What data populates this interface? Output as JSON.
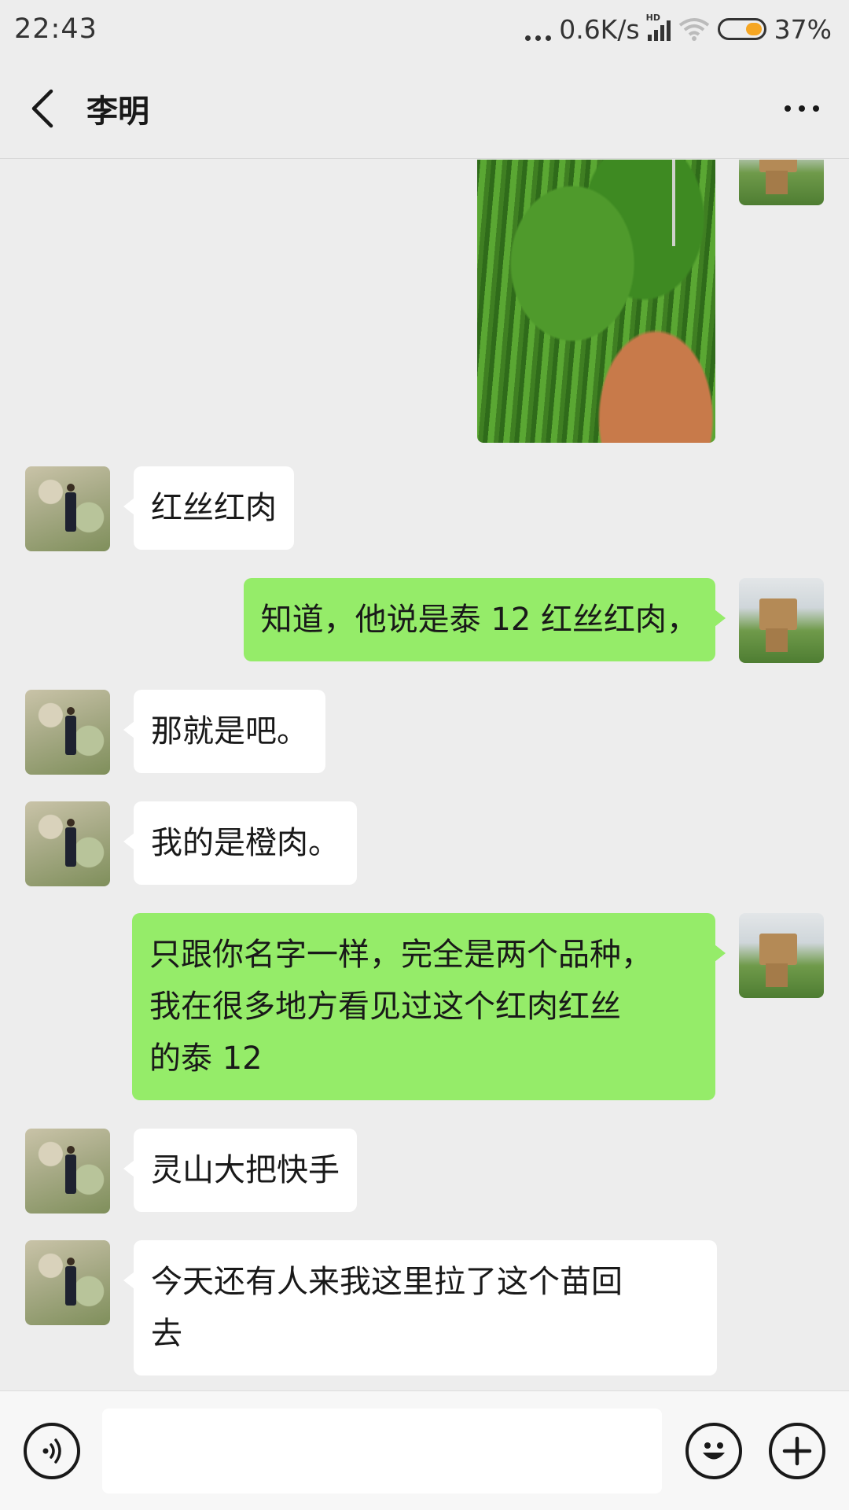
{
  "status_bar": {
    "time": "22:43",
    "network_speed": "0.6K/s",
    "signal_badge": "HD",
    "battery": "37%"
  },
  "nav": {
    "title": "李明",
    "back_icon": "chevron-left-icon",
    "more_icon": "more-dots-icon"
  },
  "messages": [
    {
      "sender": "self",
      "type": "image",
      "description_icon": "plant-nursery-photo"
    },
    {
      "sender": "friend",
      "type": "text",
      "text": "红丝红肉"
    },
    {
      "sender": "self",
      "type": "text",
      "text": "知道，他说是泰 12 红丝红肉，"
    },
    {
      "sender": "friend",
      "type": "text",
      "text": "那就是吧。"
    },
    {
      "sender": "friend",
      "type": "text",
      "text": "我的是橙肉。"
    },
    {
      "sender": "self",
      "type": "text",
      "text": "只跟你名字一样，完全是两个品种，\n我在很多地方看见过这个红肉红丝\n的泰 12"
    },
    {
      "sender": "friend",
      "type": "text",
      "text": "灵山大把快手"
    },
    {
      "sender": "friend",
      "type": "text",
      "text": "今天还有人来我这里拉了这个苗回\n去"
    }
  ],
  "input_bar": {
    "voice_icon": "voice-icon",
    "emoji_icon": "emoji-icon",
    "plus_icon": "plus-icon",
    "placeholder": ""
  },
  "colors": {
    "background": "#ededed",
    "self_bubble": "#95ec69",
    "friend_bubble": "#ffffff",
    "battery_accent": "#f5a623"
  }
}
